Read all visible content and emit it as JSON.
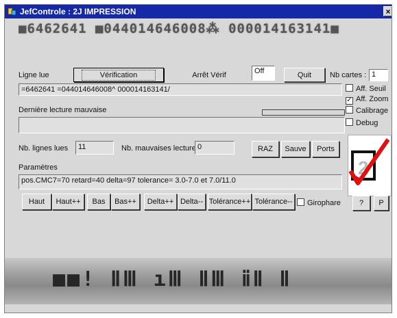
{
  "window": {
    "title": "JefControle : 2J IMPRESSION",
    "close_label": "×"
  },
  "barcode_readout": "■6462641 ■044014646008⁂ 000014163141■",
  "row1": {
    "ligne_lue_label": "Ligne lue",
    "verification_label": "Vérification",
    "arret_verif_label": "Arrêt Vérif",
    "off_value": "Off",
    "quit_label": "Quit",
    "nb_cartes_label": "Nb cartes :",
    "nb_cartes_value": "1"
  },
  "line_read_value": "=6462641 =044014646008^ 000014163141/",
  "last_bad_label": "Dernière lecture mauvaise",
  "last_bad_value": "",
  "checkboxes": [
    {
      "label": "Aff. Seuil",
      "checked": false
    },
    {
      "label": "Aff. Zoom",
      "checked": true
    },
    {
      "label": "Calibrage",
      "checked": false
    },
    {
      "label": "Debug",
      "checked": false
    }
  ],
  "counts": {
    "nb_lignes_label": "Nb. lignes lues",
    "nb_lignes_value": "11",
    "nb_mauvaises_label": "Nb. mauvaises lectures",
    "nb_mauvaises_value": "0"
  },
  "action_buttons": {
    "raz": "RAZ",
    "sauve": "Sauve",
    "ports": "Ports"
  },
  "parametres_label": "Paramètres",
  "parametres_value": "pos.CMC7=70 retard=40 delta=97 tolerance= 3.0-7.0 et 7.0/11.0",
  "adjust_buttons": [
    "Haut",
    "Haut++",
    "Bas",
    "Bas++",
    "Delta++",
    "Delta--",
    "Tolérance++",
    "Tolérance--"
  ],
  "girophare_label": "Girophare",
  "girophare_checked": false,
  "help_label": "?",
  "p_label": "P",
  "logo_digit": "2",
  "scan_glyphs": "■■! ⅡⅢ ıⅢ ⅡⅢ ⅱⅡ Ⅱ",
  "colors": {
    "titlebar": "#1428a8",
    "logo_check": "#e01010",
    "window_bg": "#d8d8d8"
  }
}
